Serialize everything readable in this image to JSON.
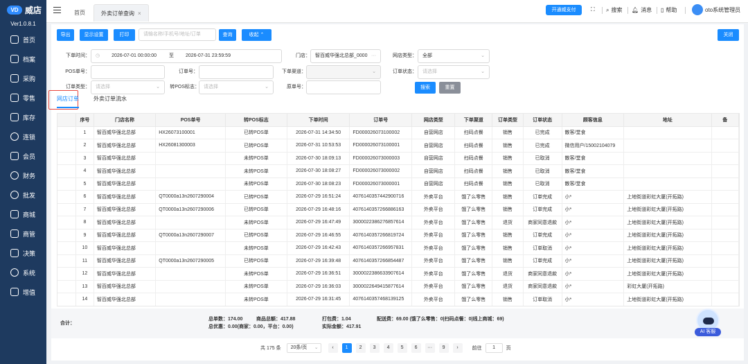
{
  "brand": {
    "name": "威店",
    "version": "Ver1.0.8.1"
  },
  "menu": [
    "首页",
    "档案",
    "采购",
    "零售",
    "库存",
    "连锁",
    "会员",
    "财务",
    "批发",
    "商城",
    "商管",
    "决策",
    "系统",
    "增值"
  ],
  "tabs": {
    "home": "首页",
    "active": "外卖订单查询"
  },
  "topbar": {
    "pay_btn": "开通威支付",
    "search": "搜索",
    "message": "消息",
    "help": "帮助",
    "user": "oto系统管理员"
  },
  "toolbar": {
    "export": "导出",
    "display": "显示设置",
    "print": "打印",
    "search_placeholder": "请输名称/手机号/地址/订单",
    "query": "查询",
    "collapse": "收起",
    "close": "关闭"
  },
  "filters": {
    "order_time_label": "下单时间：",
    "date_from": "2026-07-01 00:00:00",
    "to": "至",
    "date_to": "2026-07-31 23:59:59",
    "store_label": "门店：",
    "store_value": "智百威华强北总部_0000",
    "store_type_label": "网店类型：",
    "store_type_value": "全部",
    "pos_label": "POS单号：",
    "order_no_label": "订单号：",
    "channel_label": "下单渠道：",
    "status_label": "订单状态：",
    "status_ph": "请选择",
    "order_type_label": "订单类型：",
    "order_type_ph": "请选择",
    "pos_flag_label": "转POS标志：",
    "pos_flag_ph": "请选择",
    "orig_label": "原单号：",
    "search_btn": "搜索",
    "reset_btn": "重置"
  },
  "subtabs": [
    "网店订单",
    "外卖订单流水"
  ],
  "table": {
    "headers": [
      "",
      "序号",
      "门店名称",
      "POS单号",
      "转POS标志",
      "下单时间",
      "订单号",
      "网店类型",
      "下单渠道",
      "订单类型",
      "订单状态",
      "顾客信息",
      "地址",
      "备"
    ],
    "rows": [
      [
        "1",
        "智百威华强北总部",
        "HX26073100001",
        "已转POS单",
        "2026-07-31 14:34:50",
        "FD000026073100002",
        "自营网店",
        "扫码点餐",
        "销售",
        "已完成",
        "散客/堂食",
        ""
      ],
      [
        "2",
        "智百威华强北总部",
        "HX26081300003",
        "已转POS单",
        "2026-07-31 10:53:53",
        "FD000026073100001",
        "自营网店",
        "扫码点餐",
        "销售",
        "已完成",
        "微信用户/15002104079",
        ""
      ],
      [
        "3",
        "智百威华强北总部",
        "",
        "未转POS单",
        "2026-07-30 18:09:13",
        "FD000026073000003",
        "自营网店",
        "扫码点餐",
        "销售",
        "已取消",
        "散客/堂食",
        ""
      ],
      [
        "4",
        "智百威华强北总部",
        "",
        "未转POS单",
        "2026-07-30 18:08:27",
        "FD000026073000002",
        "自营网店",
        "扫码点餐",
        "销售",
        "已取消",
        "散客/堂食",
        ""
      ],
      [
        "5",
        "智百威华强北总部",
        "",
        "未转POS单",
        "2026-07-30 18:08:23",
        "FD000026073000001",
        "自营网店",
        "扫码点餐",
        "销售",
        "已取消",
        "散客/堂食",
        ""
      ],
      [
        "6",
        "智百威华强北总部",
        "QT0000a13n2607290004",
        "已转POS单",
        "2026-07-29 16:51:24",
        "4076140357442900716",
        "外卖平台",
        "饿了么零售",
        "销售",
        "订单完成",
        "小*",
        "上地街道彩虹大厦(开拓路)"
      ],
      [
        "7",
        "智百威华强北总部",
        "QT0000a13n2607290006",
        "已转POS单",
        "2026-07-29 16:48:16",
        "4076140357266886163",
        "外卖平台",
        "饿了么零售",
        "销售",
        "订单完成",
        "小*",
        "上地街道彩虹大厦(开拓路)"
      ],
      [
        "8",
        "智百威华强北总部",
        "",
        "未转POS单",
        "2026-07-29 16:47:49",
        "3000022386276857614",
        "外卖平台",
        "饿了么零售",
        "退货",
        "商家同意退款",
        "小*",
        "上地街道彩虹大厦(开拓路)"
      ],
      [
        "9",
        "智百威华强北总部",
        "QT0000a13n2607290007",
        "已转POS单",
        "2026-07-29 16:46:55",
        "4076140357266819724",
        "外卖平台",
        "饿了么零售",
        "销售",
        "订单完成",
        "小*",
        "上地街道彩虹大厦(开拓路)"
      ],
      [
        "10",
        "智百威华强北总部",
        "",
        "未转POS单",
        "2026-07-29 16:42:43",
        "4076140357266957831",
        "外卖平台",
        "饿了么零售",
        "销售",
        "订单取消",
        "小*",
        "上地街道彩虹大厦(开拓路)"
      ],
      [
        "11",
        "智百威华强北总部",
        "QT0000a13n2607290005",
        "已转POS单",
        "2026-07-29 16:39:48",
        "4076140357266854487",
        "外卖平台",
        "饿了么零售",
        "销售",
        "订单完成",
        "小*",
        "上地街道彩虹大厦(开拓路)"
      ],
      [
        "12",
        "智百威华强北总部",
        "",
        "未转POS单",
        "2026-07-29 16:36:51",
        "3000022386633907614",
        "外卖平台",
        "饿了么零售",
        "退货",
        "商家同意退款",
        "小*",
        "上地街道彩虹大厦(开拓路)"
      ],
      [
        "13",
        "智百威华强北总部",
        "",
        "未转POS单",
        "2026-07-29 16:36:03",
        "3000022649415877614",
        "外卖平台",
        "饿了么零售",
        "退货",
        "商家同意退款",
        "小*",
        "彩虹大厦(开拓路)"
      ],
      [
        "14",
        "智百威华强北总部",
        "",
        "未转POS单",
        "2026-07-29 16:31:45",
        "4076140357468139125",
        "外卖平台",
        "饿了么零售",
        "销售",
        "订单取消",
        "小*",
        "上地街道彩虹大厦(开拓路)"
      ]
    ]
  },
  "summary": {
    "label": "合计：",
    "total_orders": "总单数：174.00",
    "goods_total": "商品总额：417.88",
    "pack_fee": "打包费：1.04",
    "delivery_fee": "配送费：69.00 (饿了么零售：0|扫码点餐：0|线上商城：69)",
    "discount": "总优惠：0.00(商家：0.00，平台：0.00)",
    "paid": "实际金额：417.91"
  },
  "pager": {
    "total": "共 175 条",
    "size": "20条/页",
    "pages": [
      "1",
      "2",
      "3",
      "4",
      "5",
      "6",
      "···",
      "9"
    ],
    "goto": "前往",
    "goto_value": "1",
    "page_unit": "页"
  },
  "ai": {
    "label": "AI 客服"
  },
  "colors": {
    "sidebar": "#1e3a5f",
    "accent": "#1a8cff",
    "highlight": "#e8453c"
  }
}
